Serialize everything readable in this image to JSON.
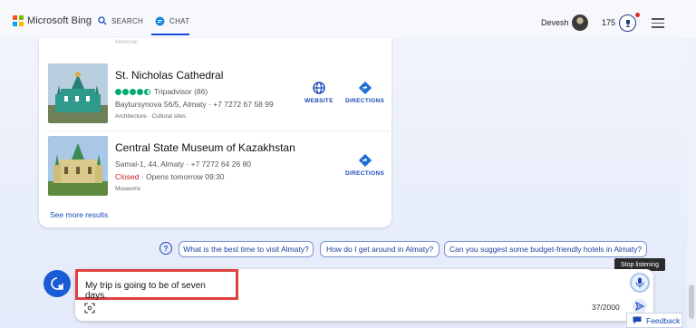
{
  "header": {
    "logo_text": "Microsoft Bing",
    "tabs": [
      {
        "label": "SEARCH",
        "icon": "search-icon"
      },
      {
        "label": "CHAT",
        "icon": "chat-icon",
        "active": true
      }
    ],
    "user_name": "Devesh",
    "points": "175",
    "colors": {
      "accent": "#174ae4",
      "ms_red": "#f25022",
      "ms_green": "#7fba00",
      "ms_blue": "#00a4ef",
      "ms_yellow": "#ffb900"
    }
  },
  "results": {
    "faded_text": "Memorial",
    "items": [
      {
        "title": "St. Nicholas Cathedral",
        "rating_source": "Tripadvisor (86)",
        "address": "Baytursynova 56/5, Almaty · +7 7272 67 58 99",
        "category": "Architecture · Cultural sites",
        "actions": [
          {
            "label": "WEBSITE",
            "icon": "globe-icon"
          },
          {
            "label": "DIRECTIONS",
            "icon": "directions-icon"
          }
        ]
      },
      {
        "title": "Central State Museum of Kazakhstan",
        "address": "Samal-1, 44, Almaty · +7 7272 64 26 80",
        "status": "Closed",
        "hours": " · Opens tomorrow 09:30",
        "category": "Museums",
        "actions": [
          {
            "label": "DIRECTIONS",
            "icon": "directions-icon"
          }
        ]
      }
    ],
    "see_more": "See more results"
  },
  "suggestions": [
    "What is the best time to visit Almaty?",
    "How do I get around in Almaty?",
    "Can you suggest some budget-friendly hotels in Almaty?"
  ],
  "composer": {
    "input_value": "My trip is going to be of seven days.",
    "char_counter": "37/2000",
    "tooltip": "Stop listening"
  },
  "feedback_label": "Feedback"
}
